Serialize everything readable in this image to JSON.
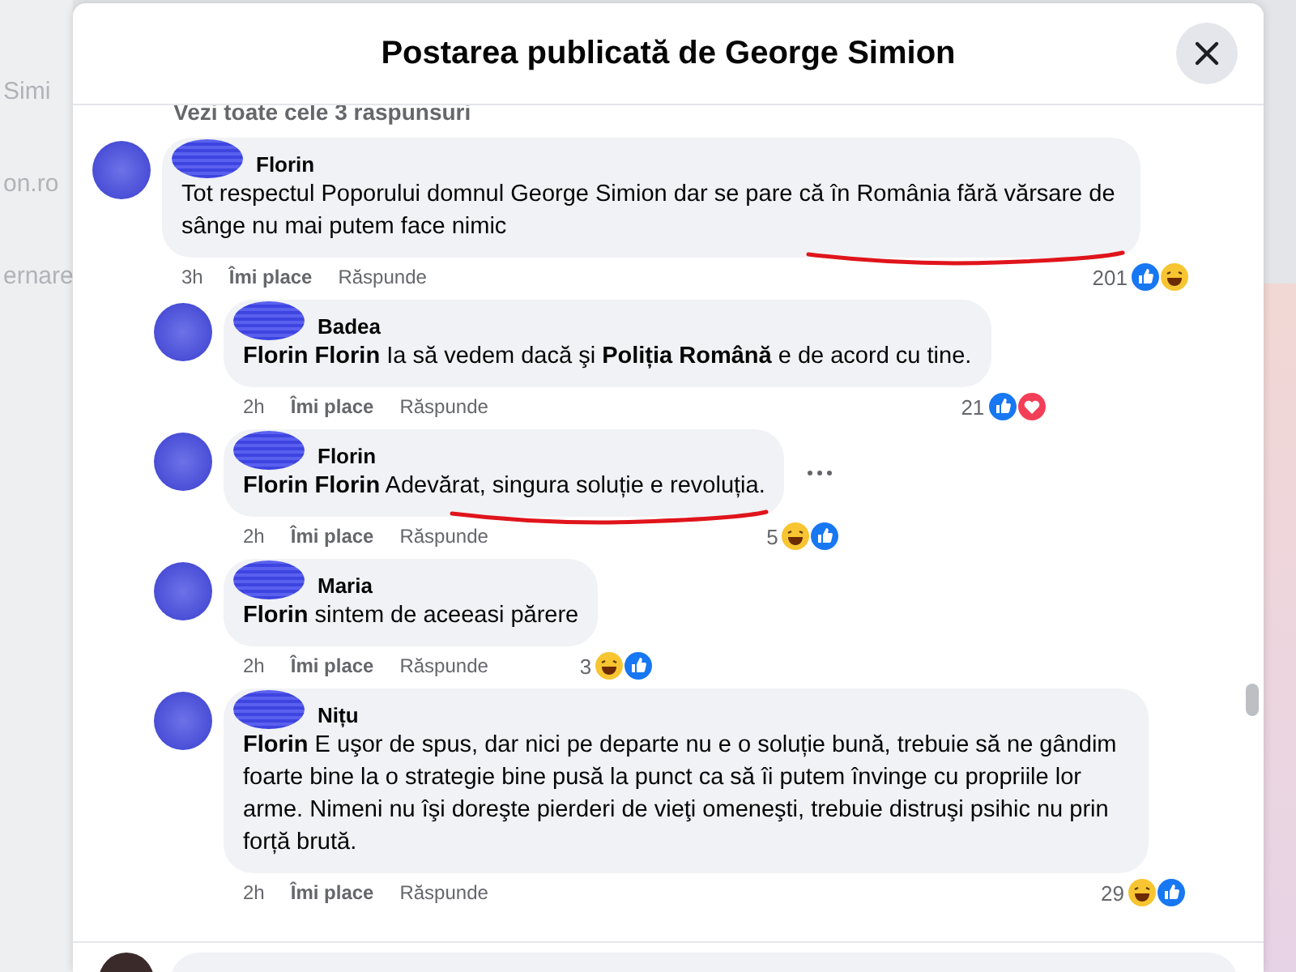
{
  "background_fragments": [
    "Simi",
    "on.ro",
    "ernare"
  ],
  "dialog": {
    "title": "Postarea publicată de George Simion"
  },
  "view_replies": "Vezi toate cele 3 raspunsuri",
  "comments": [
    {
      "author": "Florin",
      "text": "Tot respectul Poporului domnul George Simion dar se pare că în România fără vărsare de sânge nu mai putem face nimic",
      "time": "3h",
      "like": "Îmi place",
      "reply": "Răspunde",
      "count": "201",
      "reactions": [
        {
          "kind": "like"
        },
        {
          "kind": "haha"
        }
      ],
      "underlined": true,
      "options_visible": false,
      "children": [
        {
          "author": "Badea",
          "text": "**Florin Florin** Ia să vedem dacă şi **Poliția Română** e de acord cu tine.",
          "time": "2h",
          "like": "Îmi place",
          "reply": "Răspunde",
          "count": "21",
          "reactions": [
            {
              "kind": "like"
            },
            {
              "kind": "love"
            }
          ],
          "underlined": false,
          "options_visible": false
        },
        {
          "author": "Florin",
          "text": "**Florin Florin** Adevărat, singura soluție e revoluția.",
          "time": "2h",
          "like": "Îmi place",
          "reply": "Răspunde",
          "count": "5",
          "reactions": [
            {
              "kind": "haha"
            },
            {
              "kind": "like"
            }
          ],
          "underlined": true,
          "options_visible": true
        },
        {
          "author": "Maria",
          "text": "**Florin** sintem de aceeasi părere",
          "time": "2h",
          "like": "Îmi place",
          "reply": "Răspunde",
          "count": "3",
          "reactions": [
            {
              "kind": "haha"
            },
            {
              "kind": "like"
            }
          ],
          "underlined": false,
          "options_visible": false
        },
        {
          "author": "Nițu",
          "text": "**Florin** E uşor de spus, dar nici pe departe nu e o soluție bună, trebuie să ne gândim foarte bine la o strategie bine pusă la punct ca să îi putem învinge cu propriile lor arme. Nimeni nu îşi doreşte pierderi de vieţi omeneşti, trebuie distruşi psihic nu prin forță brută.",
          "time": "2h",
          "like": "Îmi place",
          "reply": "Răspunde",
          "count": "29",
          "reactions": [
            {
              "kind": "haha"
            },
            {
              "kind": "like"
            }
          ],
          "underlined": false,
          "options_visible": false
        }
      ]
    }
  ]
}
